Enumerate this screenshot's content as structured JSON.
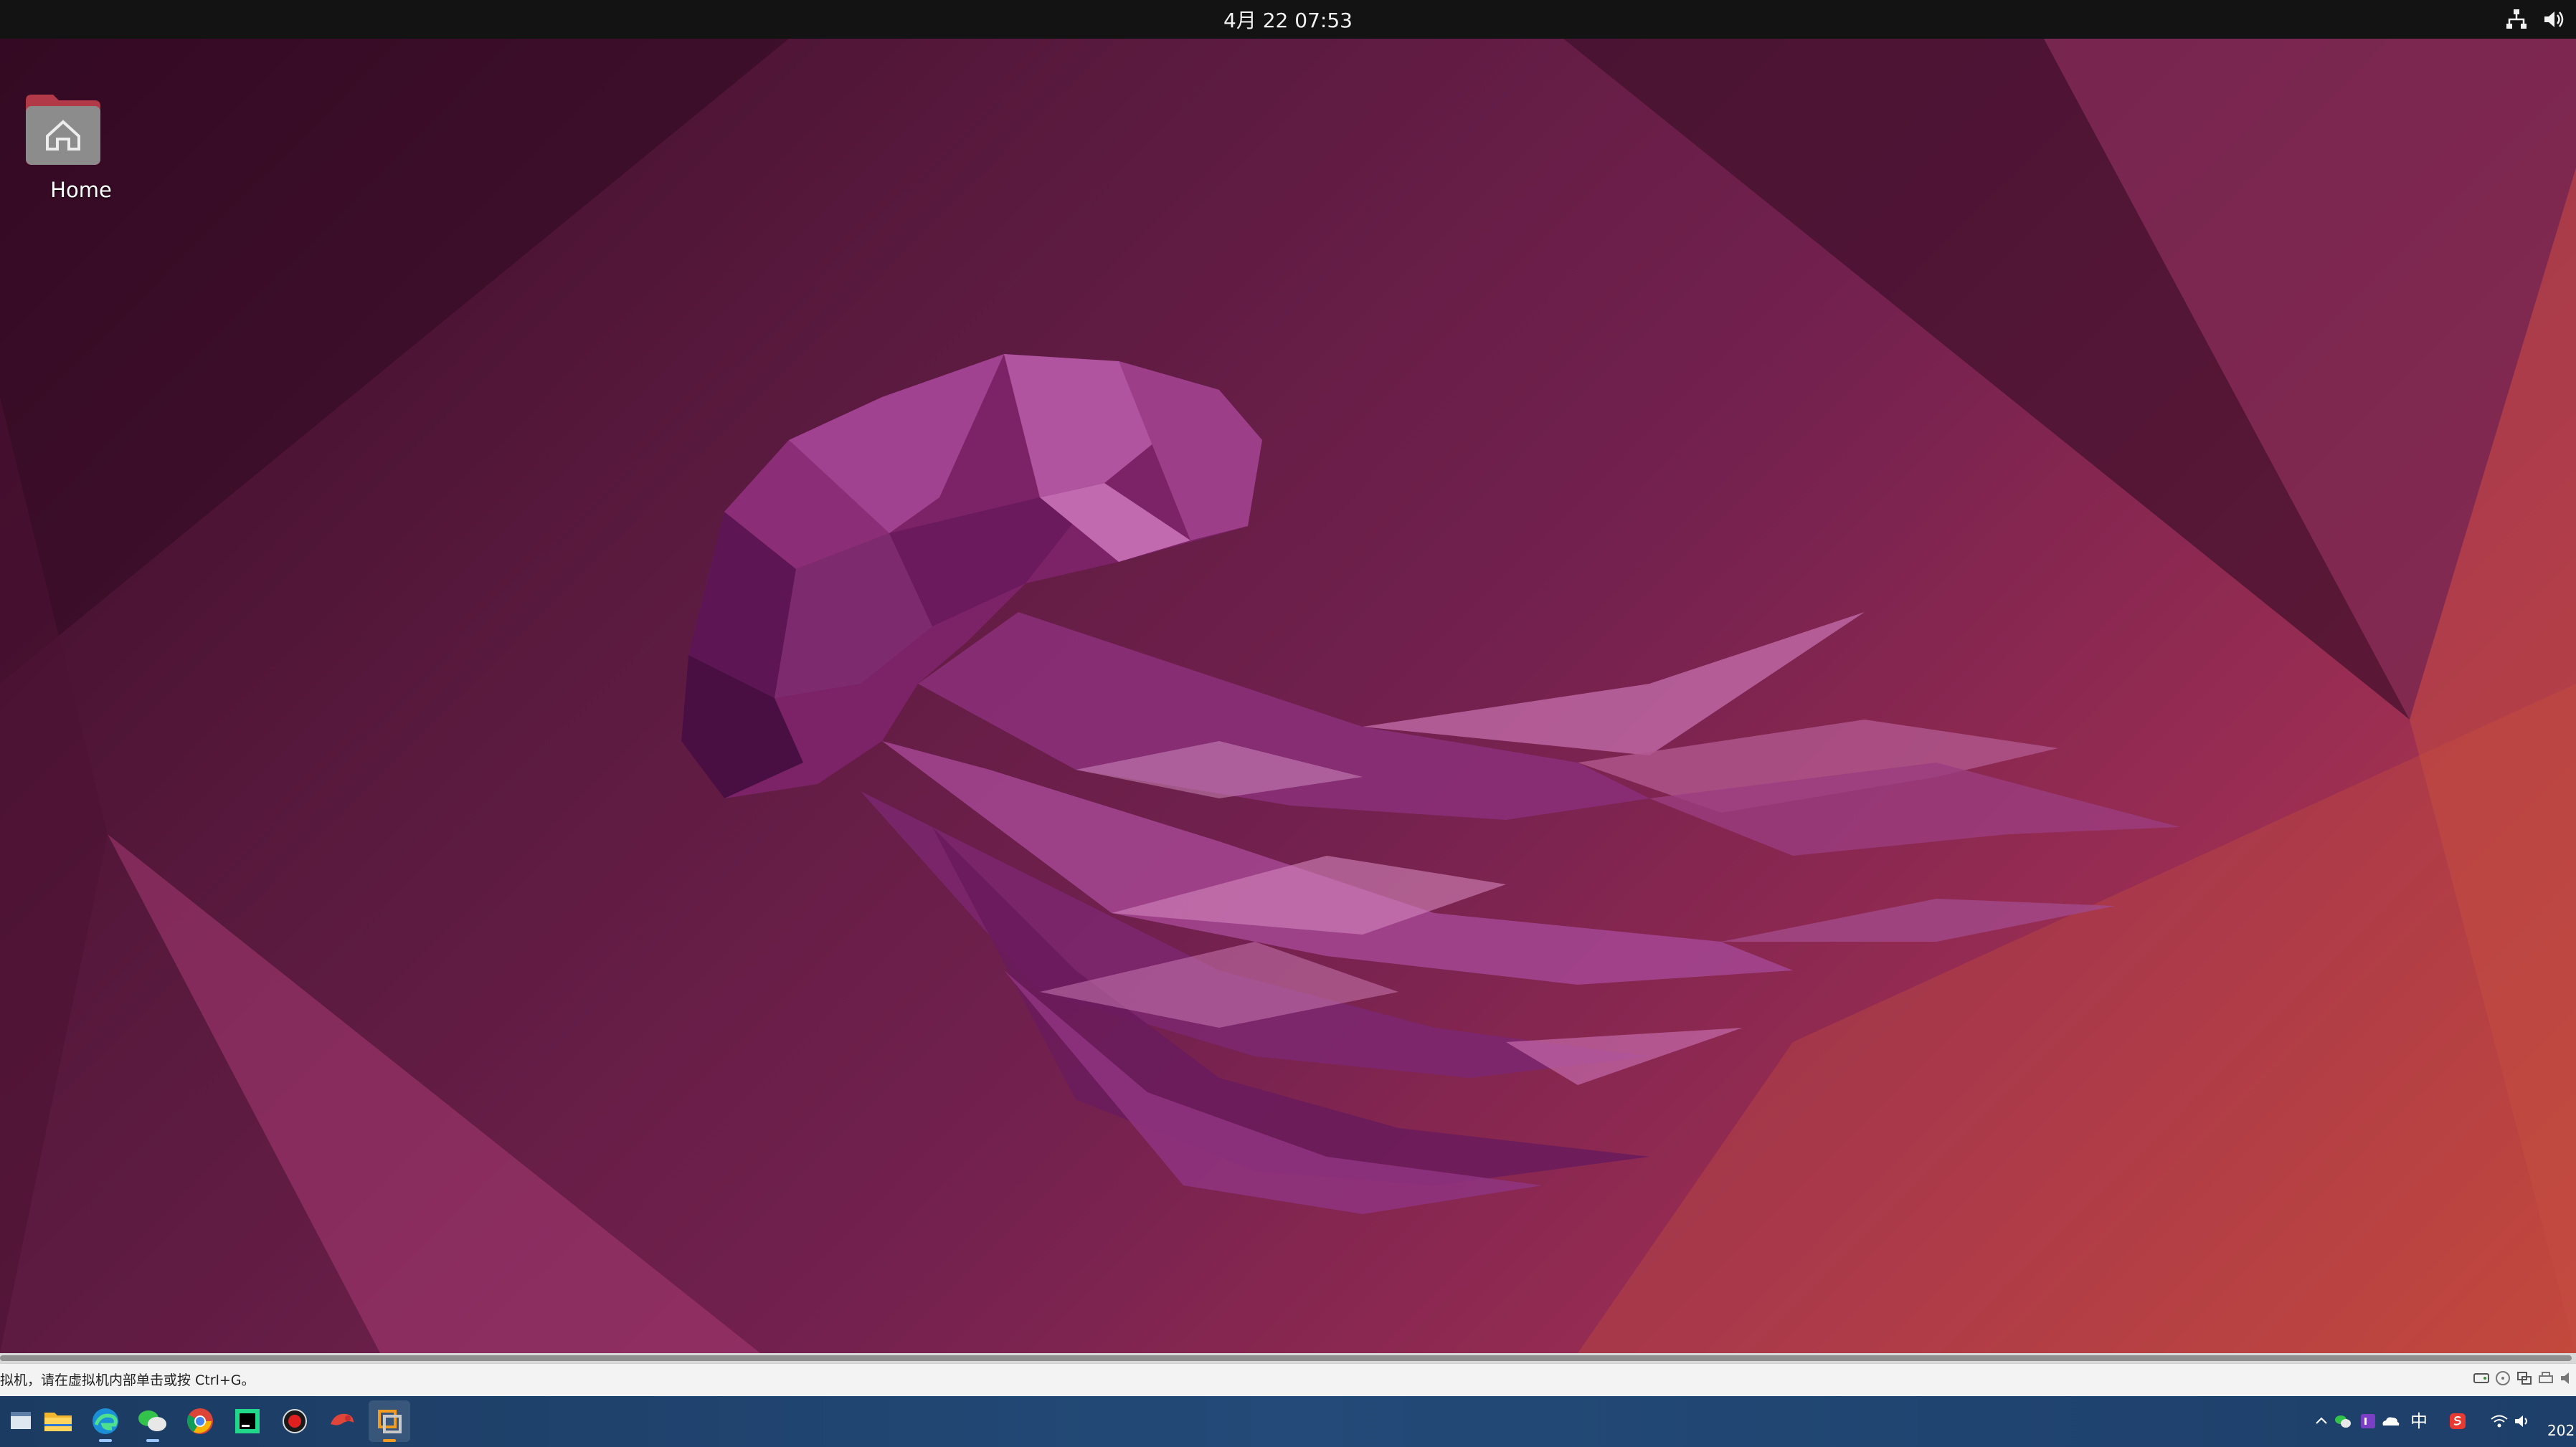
{
  "topbar": {
    "clock": "4月 22  07:53",
    "indicators": [
      "network-icon",
      "volume-icon"
    ]
  },
  "desktop": {
    "icons": [
      {
        "label": "Home",
        "icon": "home-folder-icon"
      }
    ],
    "wallpaper": "ubuntu-jammy-jellyfish"
  },
  "vm_statusbar": {
    "hint": "拟机，请在虚拟机内部单击或按 Ctrl+G。",
    "device_icons": [
      "hard-disk-icon",
      "cd-drive-icon",
      "network-adapter-icon",
      "printer-icon",
      "sound-icon"
    ]
  },
  "taskbar": {
    "apps": [
      {
        "name": "show-desktop",
        "icon": "window-icon"
      },
      {
        "name": "file-explorer",
        "icon": "folder-icon"
      },
      {
        "name": "edge",
        "icon": "edge-icon"
      },
      {
        "name": "wechat",
        "icon": "wechat-icon"
      },
      {
        "name": "chrome",
        "icon": "chrome-icon"
      },
      {
        "name": "pycharm",
        "icon": "pycharm-icon"
      },
      {
        "name": "recorder",
        "icon": "record-icon"
      },
      {
        "name": "app",
        "icon": "red-app-icon"
      },
      {
        "name": "vmware",
        "icon": "vmware-icon"
      }
    ],
    "tray": {
      "ime": "中",
      "clock_fragment": "202",
      "icons": [
        "chevron-up-icon",
        "wechat-icon",
        "onenote-icon",
        "onedrive-icon",
        "sogou-icon",
        "wifi-icon",
        "speaker-icon"
      ]
    }
  },
  "colors": {
    "topbar": "#131313",
    "taskbar": "#234a78",
    "wallpaper_dark": "#3a0b26",
    "wallpaper_warm": "#c0453d"
  }
}
